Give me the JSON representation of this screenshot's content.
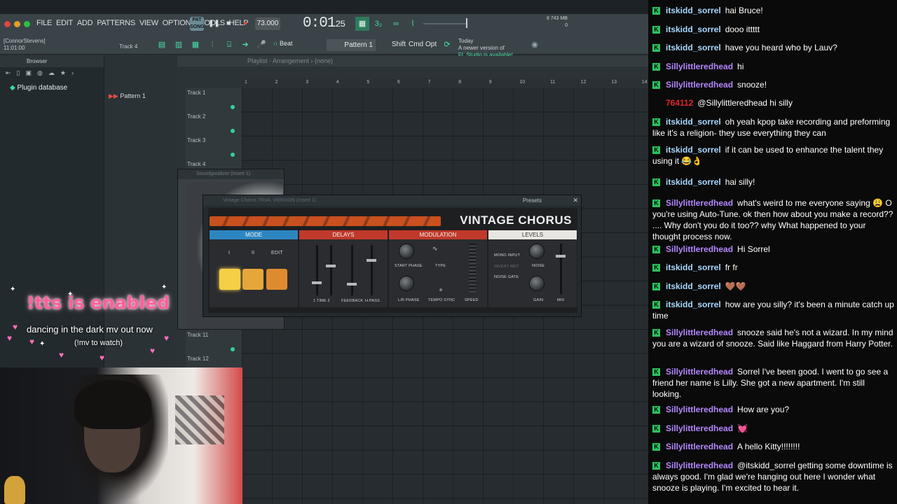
{
  "fl": {
    "menu": [
      "FILE",
      "EDIT",
      "ADD",
      "PATTERNS",
      "VIEW",
      "OPTIONS",
      "TOOLS",
      "HELP"
    ],
    "pat_badge": "PAT SONG",
    "tempo": "73.000",
    "time": "0:01",
    "time_small": "25",
    "time_sig": "3₂",
    "perf_line1": "8     743 MB",
    "perf_line2": "0",
    "user_name": "[ConnorStevens]",
    "user_time": "11:01:00",
    "track_select": "Track 4",
    "beat_label": "Beat",
    "pattern_select": "Pattern 1",
    "shift": "Shift",
    "cmd": "Cmd",
    "opt": "Opt",
    "news_line1": "Today",
    "news_line2": "A newer version of",
    "news_line3": "FL Studio is available!",
    "browser_title": "Browser",
    "plugin_db": "Plugin database",
    "pattern_item": "Pattern 1",
    "playlist_path": "Playlist · Arrangement › (none)",
    "ruler": [
      "1",
      "2",
      "3",
      "4",
      "5",
      "6",
      "7",
      "8",
      "9",
      "10",
      "11",
      "12",
      "13",
      "14"
    ],
    "tracks": [
      "Track 1",
      "Track 2",
      "Track 3",
      "Track 4",
      "Track 11",
      "Track 12"
    ],
    "soundgoodizer_title": "Soundgoodizer (Insert 1)",
    "vc_title": "Vintage Chorus TRIAL VERSION (Insert 1)",
    "vc_presets": "Presets",
    "vc_name": "VINTAGE CHORUS",
    "vc_sections": {
      "mode": "MODE",
      "delays": "DELAYS",
      "modulation": "MODULATION",
      "levels": "LEVELS"
    },
    "vc_labels": {
      "mode_i": "I",
      "mode_ii": "II",
      "edit": "EDIT",
      "time": "1   TIME   2",
      "feedback": "FEEDBACK",
      "hpass": "H.PASS",
      "start_phase": "START PHASE",
      "type": "TYPE",
      "lr_phase": "L/R PHASE",
      "tempo_sync": "TEMPO SYNC",
      "speed": "SPEED",
      "mono_input": "MONO INPUT",
      "invert_wet": "INVERT WET",
      "noise_gate": "NOISE GATE",
      "noise": "NOISE",
      "gain": "GAIN",
      "mix": "MIX"
    }
  },
  "overlay": {
    "tts": "!tts is enabled",
    "dark": "dancing in the dark mv out now",
    "watch": "(!mv to watch)"
  },
  "colors": {
    "mode": "#2e86c1",
    "delays": "#c0392b",
    "modulation": "#c0392b",
    "levels": "#e8e6e1",
    "chat_badge": "#2bc25f"
  },
  "chat": [
    {
      "user": "itskidd_sorrel",
      "color": "#a7d8ff",
      "text": "hai Bruce!"
    },
    {
      "user": "itskidd_sorrel",
      "color": "#a7d8ff",
      "text": "dooo ittttt"
    },
    {
      "user": "itskidd_sorrel",
      "color": "#a7d8ff",
      "text": "have you heard who by Lauv?"
    },
    {
      "user": "Sillylittleredhead",
      "color": "#b487ff",
      "text": "hi"
    },
    {
      "user": "Sillylittleredhead",
      "color": "#b487ff",
      "text": "snooze!"
    },
    {
      "user": "764112",
      "color": "#e0262b",
      "text": "@Sillylittleredhead hi silly",
      "badge": false
    },
    {
      "user": "itskidd_sorrel",
      "color": "#a7d8ff",
      "text": "oh yeah kpop take recording and preforming like it's a religion- they use everything they can"
    },
    {
      "user": "itskidd_sorrel",
      "color": "#a7d8ff",
      "text": "if it can be used to enhance the talent they using it 😂👌"
    },
    {
      "user": "itskidd_sorrel",
      "color": "#a7d8ff",
      "text": "hai silly!"
    },
    {
      "user": "Sillylittleredhead",
      "color": "#b487ff",
      "text": "what's weird to me everyone saying 😩 O you're using Auto-Tune. ok then how about you make a record?? .... Why don't you do it too?? why What happened to your thought process now."
    },
    {
      "user": "Sillylittleredhead",
      "color": "#b487ff",
      "text": "Hi Sorrel"
    },
    {
      "user": "itskidd_sorrel",
      "color": "#a7d8ff",
      "text": "fr fr"
    },
    {
      "user": "itskidd_sorrel",
      "color": "#a7d8ff",
      "text": "🤎🤎"
    },
    {
      "user": "itskidd_sorrel",
      "color": "#a7d8ff",
      "text": "how are you silly? it's been a minute catch up time"
    },
    {
      "user": "Sillylittleredhead",
      "color": "#b487ff",
      "text": "snooze said he's not a wizard. In my mind you are a wizard of snooze. Said like Haggard from Harry Potter."
    },
    {
      "user": "Sillylittleredhead",
      "color": "#b487ff",
      "text": "Sorrel I've been good. I went to go see a friend her name is Lilly. She got a new apartment. I'm still looking."
    },
    {
      "user": "Sillylittleredhead",
      "color": "#b487ff",
      "text": "How are you?"
    },
    {
      "user": "Sillylittleredhead",
      "color": "#b487ff",
      "text": "💓"
    },
    {
      "user": "Sillylittleredhead",
      "color": "#b487ff",
      "text": "A hello Kitty!!!!!!!!"
    },
    {
      "user": "Sillylittleredhead",
      "color": "#b487ff",
      "text": "@itskidd_sorrel getting some downtime is always good. I'm glad we're hanging out here I wonder what snooze is playing. I'm excited to hear it."
    }
  ]
}
